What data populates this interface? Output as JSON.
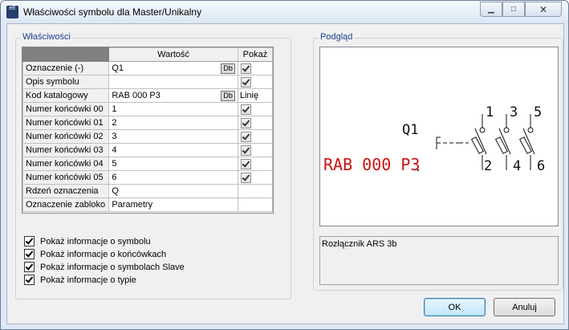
{
  "window": {
    "title": "Właściwości symbolu dla Master/Unikalny",
    "icon_text": "eE"
  },
  "properties": {
    "group_label": "Właściwości",
    "columns": {
      "value": "Wartość",
      "show": "Pokaż"
    },
    "rows": [
      {
        "label": "Oznaczenie (-)",
        "value": "Q1",
        "db": "Db",
        "show": true
      },
      {
        "label": "Opis symbolu",
        "value": "",
        "show": true
      },
      {
        "label": "Kod katalogowy",
        "value": "RAB 000 P3",
        "db": "Db",
        "show_text": "Linię"
      },
      {
        "label": "Numer końcówki 00",
        "value": "1",
        "show": true
      },
      {
        "label": "Numer końcówki 01",
        "value": "2",
        "show": true
      },
      {
        "label": "Numer końcówki 02",
        "value": "3",
        "show": true
      },
      {
        "label": "Numer końcówki 03",
        "value": "4",
        "show": true
      },
      {
        "label": "Numer końcówki 04",
        "value": "5",
        "show": true
      },
      {
        "label": "Numer końcówki 05",
        "value": "6",
        "show": true
      },
      {
        "label": "Rdzeń oznaczenia",
        "value": "Q"
      },
      {
        "label": "Oznaczenie zabloko",
        "value": "Parametry"
      }
    ]
  },
  "options": [
    {
      "label": "Pokaż informacje o symbolu",
      "checked": true
    },
    {
      "label": "Pokaż informacje o końcówkach",
      "checked": true
    },
    {
      "label": "Pokaż informacje o symbolach Slave",
      "checked": true
    },
    {
      "label": "Pokaż informacje o typie",
      "checked": true
    }
  ],
  "preview": {
    "group_label": "Podgląd",
    "designation": "Q1",
    "catalog_code": "RAB 000 P3",
    "terminals_top": [
      "1",
      "3",
      "5"
    ],
    "terminals_bottom": [
      "2",
      "4",
      "6"
    ],
    "catalog_color": "#cc1010",
    "description": "Rozłącznik ARS 3b"
  },
  "buttons": {
    "ok": "OK",
    "cancel": "Anuluj"
  }
}
